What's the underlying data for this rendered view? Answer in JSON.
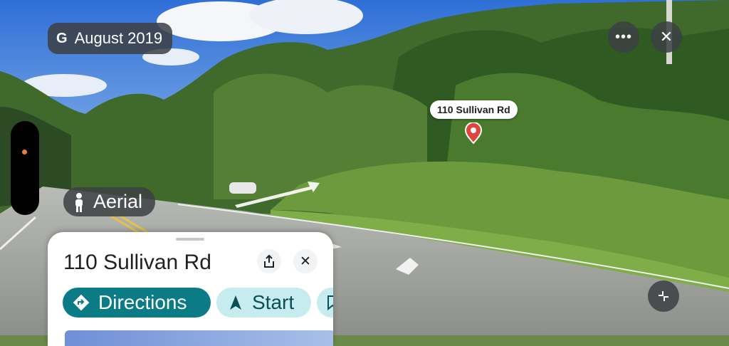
{
  "header": {
    "date_label": "August 2019",
    "date_icon": "google-g-icon",
    "more_icon": "more-horizontal-icon",
    "more_glyph": "•••",
    "close_icon": "close-icon",
    "close_glyph": "✕"
  },
  "side": {
    "aerial_label": "Aerial",
    "aerial_icon": "pegman-icon"
  },
  "marker": {
    "label": "110 Sullivan Rd",
    "icon": "map-pin-icon"
  },
  "sheet": {
    "title": "110 Sullivan Rd",
    "share_icon": "share-icon",
    "close_icon": "close-icon",
    "close_glyph": "✕",
    "directions_label": "Directions",
    "directions_icon": "directions-diamond-icon",
    "start_label": "Start",
    "start_icon": "navigation-arrow-icon",
    "next_icon": "bookmark-icon"
  },
  "controls": {
    "collapse_icon": "collapse-icon"
  },
  "colors": {
    "accent": "#0b7c86",
    "chip_bg": "#3c4043",
    "pin": "#e0443e",
    "zoom_dot": "#f07b3f"
  }
}
